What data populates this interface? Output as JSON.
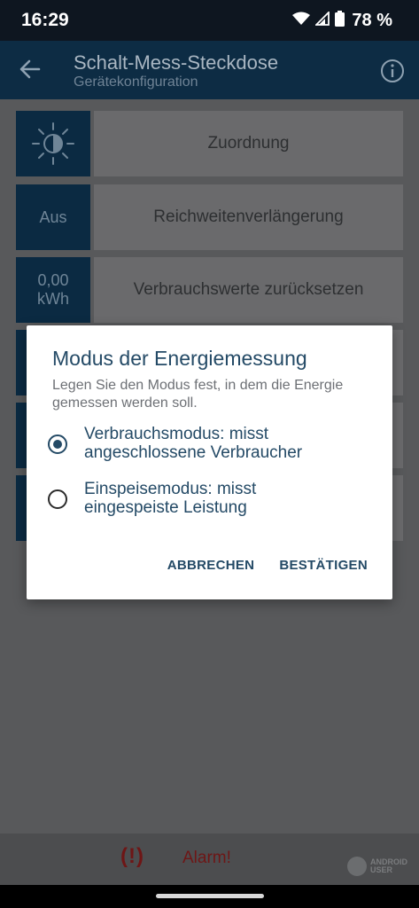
{
  "status_bar": {
    "time": "16:29",
    "battery": "78 %",
    "icons": [
      "wifi-icon",
      "signal-icon",
      "battery-icon"
    ]
  },
  "app_bar": {
    "title": "Schalt-Mess-Steckdose",
    "subtitle": "Gerätekonfiguration",
    "back_icon": "arrow-left-icon",
    "info_icon": "info-icon"
  },
  "settings": {
    "rows": [
      {
        "box": "",
        "box_icon": "brightness-icon",
        "label": "Zuordnung"
      },
      {
        "box": "Aus",
        "label": "Reichweitenverlängerung"
      },
      {
        "box_line1": "0,00",
        "box_line2": "kWh",
        "label": "Verbrauchswerte zurücksetzen"
      }
    ]
  },
  "dialog": {
    "title": "Modus der Energiemessung",
    "message": "Legen Sie den Modus fest, in dem die Energie gemessen werden soll.",
    "options": [
      {
        "label_line1": "Verbrauchsmodus: misst",
        "label_line2": "angeschlossene Verbraucher",
        "selected": true
      },
      {
        "label_line1": "Einspeisemodus: misst",
        "label_line2": "eingespeiste Leistung",
        "selected": false
      }
    ],
    "cancel": "ABBRECHEN",
    "confirm": "BESTÄTIGEN"
  },
  "bottom_bar": {
    "alarm_icon": "(!)",
    "alarm_label": "Alarm!",
    "watermark_line1": "ANDROID",
    "watermark_line2": "USER"
  },
  "colors": {
    "primary": "#0d2c44",
    "dialog_accent": "#244a66",
    "alarm": "#6e1616"
  }
}
